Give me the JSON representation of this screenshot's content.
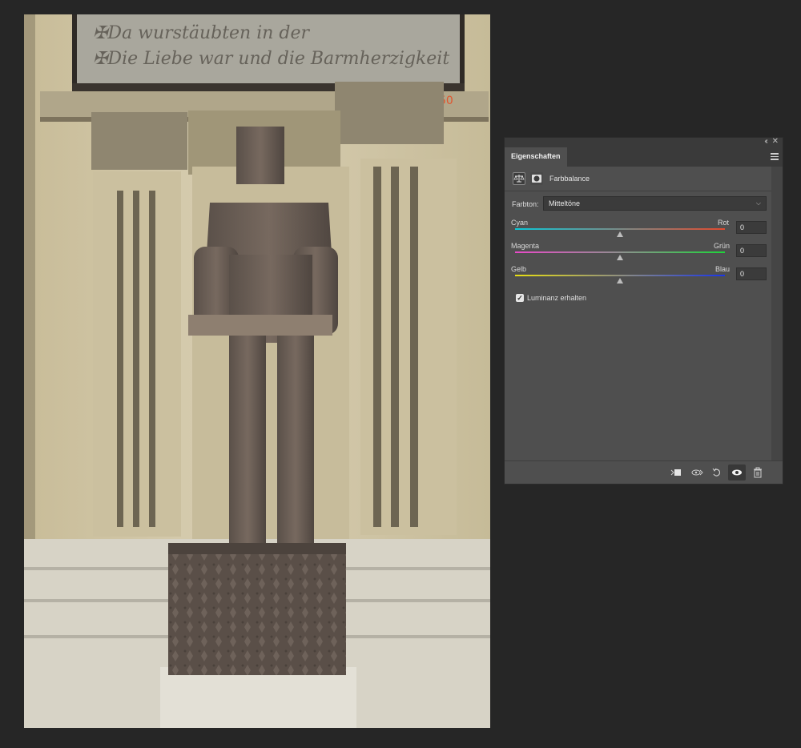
{
  "window": {
    "collapse_glyph": "‹‹",
    "close_glyph": "✕"
  },
  "panel": {
    "tab_label": "Eigenschaften",
    "header_label": "Farbbalance",
    "header_icons": [
      "scales-icon",
      "mask-icon"
    ],
    "farbton": {
      "label": "Farbton:",
      "value": "Mitteltöne",
      "chevron": "⌵"
    },
    "sliders": [
      {
        "left_label": "Cyan",
        "right_label": "Rot",
        "value": "0",
        "position_fraction": 0.5,
        "colors": [
          "#0bc8d8",
          "#e24a2e"
        ]
      },
      {
        "left_label": "Magenta",
        "right_label": "Grün",
        "value": "0",
        "position_fraction": 0.5,
        "colors": [
          "#e84ac8",
          "#1ed43a"
        ]
      },
      {
        "left_label": "Gelb",
        "right_label": "Blau",
        "value": "0",
        "position_fraction": 0.5,
        "colors": [
          "#e8df12",
          "#1a36e8"
        ]
      }
    ],
    "luminanz": {
      "label": "Luminanz erhalten",
      "checked": true,
      "check_glyph": "✓"
    },
    "bottom_icons": [
      "clip-to-layer-icon",
      "view-previous-state-icon",
      "reset-icon",
      "visibility-eye-icon",
      "trash-icon"
    ]
  },
  "photo": {
    "inscription_line_1": "✠Da wurstäubten in der",
    "inscription_line_2": "✠Die Liebe war und die Barmherzigkeit",
    "wall_mark": "50"
  },
  "colors": {
    "app_background": "#262626",
    "panel_background": "#4f4f4f",
    "panel_dark": "#3a3a3a"
  }
}
